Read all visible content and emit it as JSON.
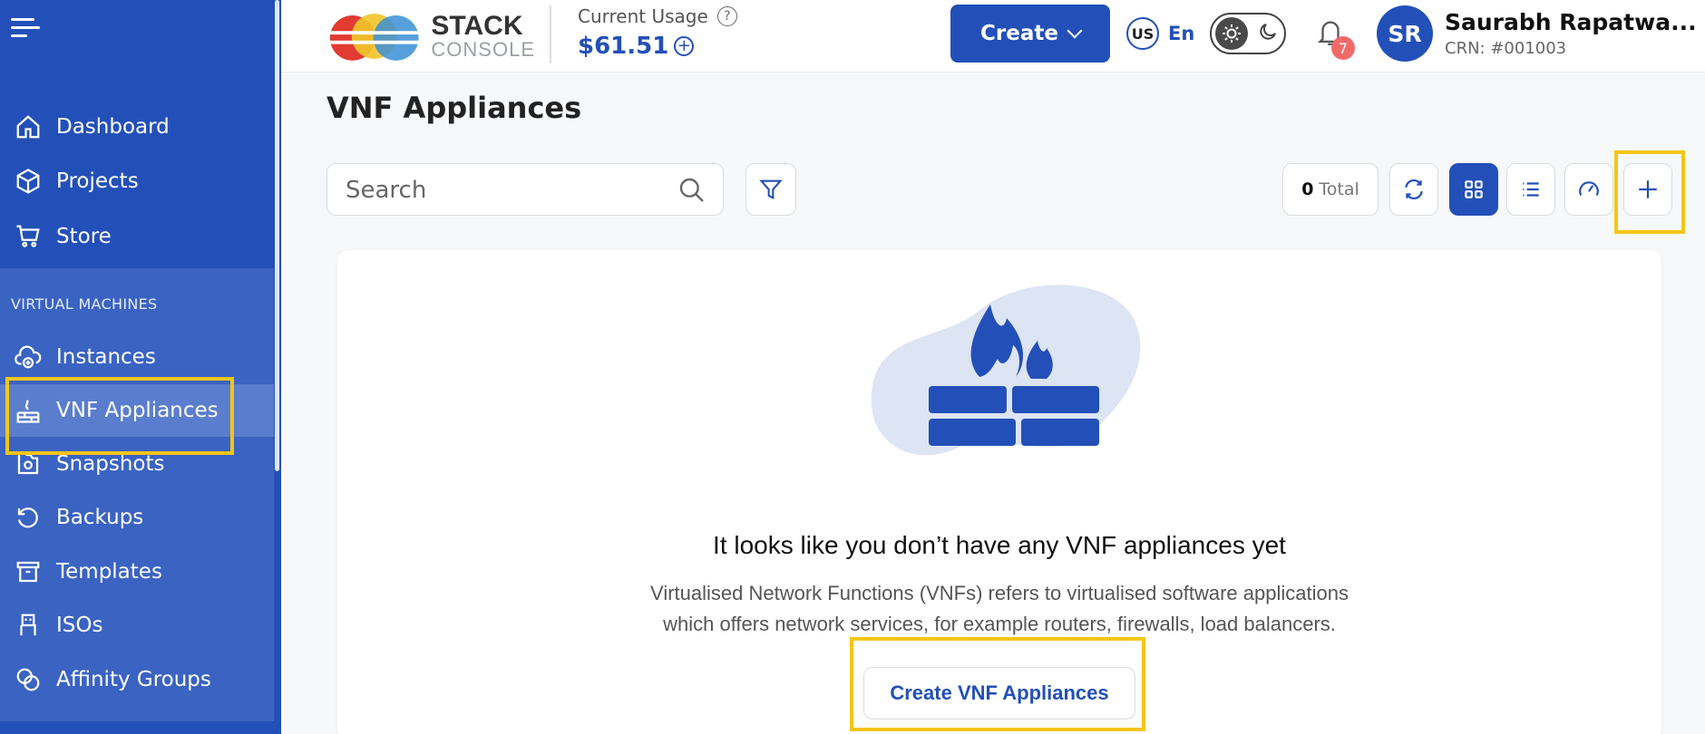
{
  "sidebar": {
    "top_items": [
      {
        "label": "Dashboard",
        "icon": "home-icon"
      },
      {
        "label": "Projects",
        "icon": "cube-icon"
      },
      {
        "label": "Store",
        "icon": "cart-icon"
      }
    ],
    "section_label": "VIRTUAL MACHINES",
    "vm_items": [
      {
        "label": "Instances",
        "icon": "cloud-plus-icon"
      },
      {
        "label": "VNF Appliances",
        "icon": "firewall-icon",
        "active": true
      },
      {
        "label": "Snapshots",
        "icon": "camera-icon"
      },
      {
        "label": "Backups",
        "icon": "history-icon"
      },
      {
        "label": "Templates",
        "icon": "archive-icon"
      },
      {
        "label": "ISOs",
        "icon": "usb-icon"
      },
      {
        "label": "Affinity Groups",
        "icon": "rings-icon"
      }
    ]
  },
  "header": {
    "logo_line1": "STACK",
    "logo_line2": "CONSOLE",
    "usage_label": "Current Usage",
    "usage_value": "$61.51",
    "create_label": "Create",
    "lang_code": "US",
    "lang_label": "En",
    "notification_count": "7",
    "avatar_initials": "SR",
    "user_name": "Saurabh Rapatwa...",
    "user_crn": "CRN: #001003"
  },
  "main": {
    "title": "VNF Appliances",
    "search_placeholder": "Search",
    "total_count": "0",
    "total_label": "Total",
    "empty_title": "It looks like you don’t have any VNF appliances yet",
    "empty_desc_line1": "Virtualised Network Functions (VNFs) refers to virtualised software applications",
    "empty_desc_line2": "which offers network services, for example routers, firewalls, load balancers.",
    "empty_button": "Create VNF Appliances"
  },
  "colors": {
    "brand": "#2350b8",
    "highlight": "#f5c518",
    "badge": "#f06a6a"
  }
}
